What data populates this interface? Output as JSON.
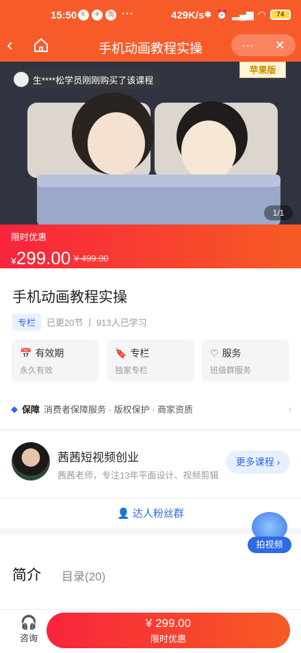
{
  "status": {
    "time": "15:50",
    "icons": [
      "K",
      "✈",
      "淘"
    ],
    "more": "···",
    "net": "429K/s",
    "battery": "74"
  },
  "nav": {
    "title": "手机动画教程实操",
    "more": "···",
    "close": "✕"
  },
  "hero": {
    "buyer_text": "生****松学员刚刚购买了该课程",
    "apple_tag": "苹果版",
    "pager": "1/1"
  },
  "price": {
    "label": "限时优惠",
    "currency": "¥",
    "current": "299.00",
    "original": "¥ 499.00"
  },
  "course": {
    "title": "手机动画教程实操",
    "chip": "专栏",
    "updated": "已更20节",
    "learners": "913人已学习",
    "features": [
      {
        "title": "有效期",
        "sub": "永久有效"
      },
      {
        "title": "专栏",
        "sub": "独家专栏"
      },
      {
        "title": "服务",
        "sub": "班级群服务"
      }
    ],
    "guarantee": {
      "label": "保障",
      "text": "消费者保障服务 · 版权保护 · 商家资质"
    }
  },
  "teacher": {
    "name": "茜茜短视频创业",
    "desc": "茜茜老师，专注13年平面设计、视频剪辑",
    "more": "更多课程 ›",
    "fans": "达人粉丝群"
  },
  "tabs": {
    "intro": "简介",
    "catalog": "目录(20)"
  },
  "float": {
    "video": "拍视频"
  },
  "bottom": {
    "consult": "咨询",
    "price": "¥ 299.00",
    "promo": "限时优惠"
  }
}
